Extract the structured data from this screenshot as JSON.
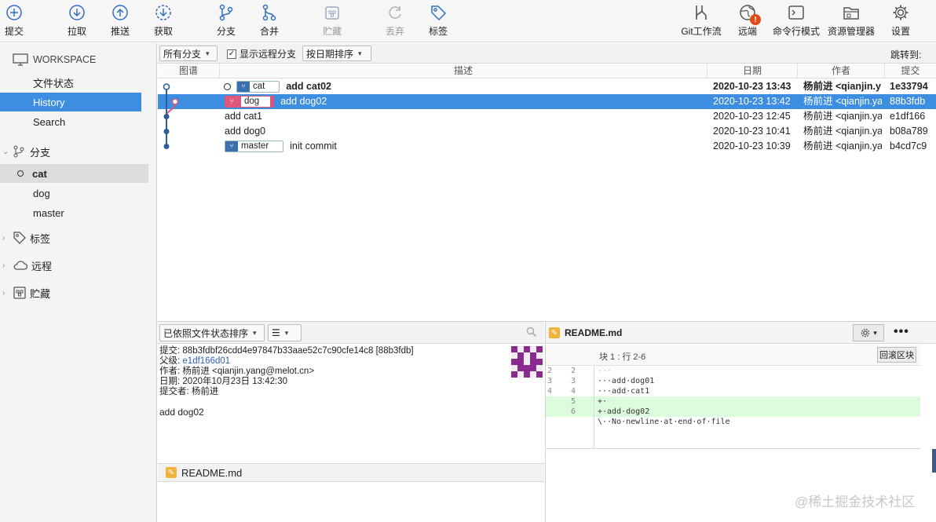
{
  "toolbar": {
    "left": [
      {
        "label": "提交",
        "icon": "commit-plus-icon"
      },
      {
        "label": "拉取",
        "icon": "pull-down-icon"
      },
      {
        "label": "推送",
        "icon": "push-up-icon"
      },
      {
        "label": "获取",
        "icon": "fetch-icon"
      },
      {
        "label": "分支",
        "icon": "branch-icon"
      },
      {
        "label": "合并",
        "icon": "merge-icon"
      },
      {
        "label": "贮藏",
        "icon": "stash-icon",
        "disabled": true
      },
      {
        "label": "丢弃",
        "icon": "discard-icon",
        "disabled": true
      },
      {
        "label": "标签",
        "icon": "tag-icon"
      }
    ],
    "right": [
      {
        "label": "Git工作流",
        "icon": "git-flow-icon"
      },
      {
        "label": "远端",
        "icon": "remote-globe-icon"
      },
      {
        "label": "命令行模式",
        "icon": "terminal-icon"
      },
      {
        "label": "资源管理器",
        "icon": "explorer-folder-icon"
      },
      {
        "label": "设置",
        "icon": "gear-icon"
      }
    ]
  },
  "sidebar": {
    "workspace": "WORKSPACE",
    "workspace_items": [
      "文件状态",
      "History",
      "Search"
    ],
    "branches_header": "分支",
    "branches": [
      "cat",
      "dog",
      "master"
    ],
    "tags_header": "标签",
    "remotes_header": "远程",
    "stash_header": "贮藏"
  },
  "filterbar": {
    "branches_dropdown": "所有分支",
    "show_remote_label": "显示远程分支",
    "show_remote_checked": true,
    "sort_dropdown": "按日期排序",
    "jump_to": "跳转到:"
  },
  "columns": {
    "graph": "图谱",
    "description": "描述",
    "date": "日期",
    "author": "作者",
    "commit": "提交"
  },
  "commits": [
    {
      "tag": "cat",
      "desc": "add cat02",
      "date": "2020-10-23 13:43",
      "author": "杨前进 <qianjin.y",
      "hash": "1e33794",
      "bold": true
    },
    {
      "tag": "dog",
      "desc": "add dog02",
      "date": "2020-10-23 13:42",
      "author": "杨前进 <qianjin.ya",
      "hash": "88b3fdb",
      "selected": true
    },
    {
      "tag": "",
      "desc": "add cat1",
      "date": "2020-10-23 12:45",
      "author": "杨前进 <qianjin.ya",
      "hash": "e1df166"
    },
    {
      "tag": "",
      "desc": "add dog0",
      "date": "2020-10-23 10:41",
      "author": "杨前进 <qianjin.ya",
      "hash": "b08a789"
    },
    {
      "tag": "master",
      "desc": "init commit",
      "date": "2020-10-23 10:39",
      "author": "杨前进 <qianjin.ya",
      "hash": "b4cd7c9"
    }
  ],
  "details_bar": {
    "sort_dropdown": "已依照文件状态排序",
    "view_dropdown": "☰"
  },
  "details": {
    "commit_label": "提交:",
    "commit_value": "88b3fdbf26cdd4e97847b33aae52c7c90cfe14c8 [88b3fdb]",
    "parent_label": "父级:",
    "parent_value": "e1df166d01",
    "author_label": "作者:",
    "author_value": "杨前进 <qianjin.yang@melot.cn>",
    "date_label": "日期:",
    "date_value": "2020年10月23日 13:42:30",
    "committer_label": "提交者:",
    "committer_value": "杨前进",
    "message": "add dog02"
  },
  "changed_file": "README.md",
  "diff": {
    "file": "README.md",
    "hunk_label": "块 1 :  行 2-6",
    "revert_button": "回滚区块",
    "lines": [
      {
        "a": "2",
        "b": "2",
        "text": "···",
        "add": false
      },
      {
        "a": "3",
        "b": "3",
        "text": "···add·dog01",
        "add": false
      },
      {
        "a": "4",
        "b": "4",
        "text": "···add·cat1",
        "add": false
      },
      {
        "a": "",
        "b": "5",
        "text": "+·",
        "add": true
      },
      {
        "a": "",
        "b": "6",
        "text": "+·add·dog02",
        "add": true
      },
      {
        "a": "",
        "b": "",
        "text": "\\··No·newline·at·end·of·file",
        "add": false
      }
    ]
  },
  "watermark": "@稀土掘金技术社区",
  "colors": {
    "accent": "#3d8ee0",
    "dog_tag": "#e0557a",
    "branch_tag": "#3a6fb0",
    "added_line": "#ddfbdd"
  }
}
